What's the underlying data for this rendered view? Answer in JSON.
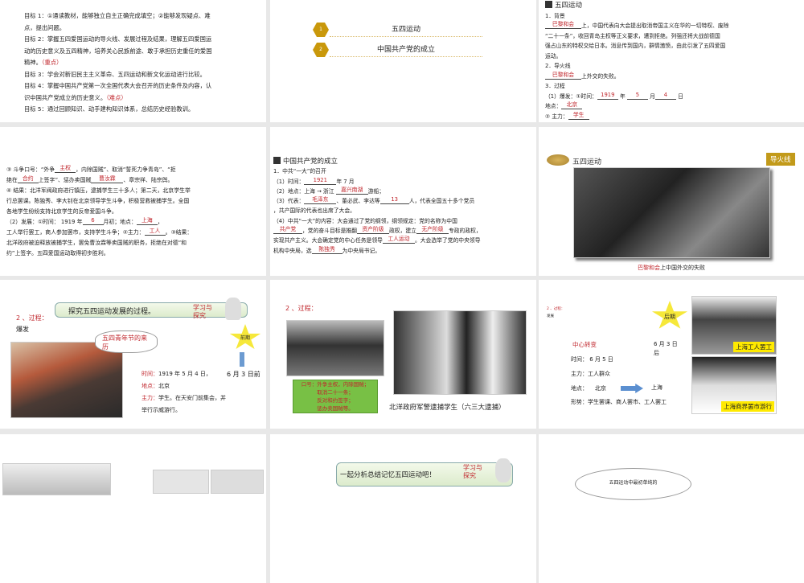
{
  "slide1": {
    "lines": [
      {
        "text": "目标 1：①通读教材，能够独立自主正确完成填空；②能够发现疑点、难"
      },
      {
        "text": "点，提出问题。"
      },
      {
        "text": "目标 2：掌握五四爱国运动的导火线、发展过程及结果，理解五四爱国运"
      },
      {
        "text": "动的历史意义及五四精神，培养关心民族前途、敢于承担历史重任的爱国"
      },
      {
        "text": "精神。",
        "mark": "（重点）"
      },
      {
        "text": "目标 3：学会对新旧民主主义革命、五四运动和新文化运动进行比较。"
      },
      {
        "text": "目标 4：掌握中国共产党第一次全国代表大会召开的历史条件及内容，认"
      },
      {
        "text": "识中国共产党成立的历史意义。",
        "mark": "（难点）"
      },
      {
        "text": "目标 5：通过回顾知识、动手建构知识体系，总结历史经验教训。"
      }
    ]
  },
  "slide2": {
    "items": [
      {
        "num": "1",
        "title": "五四运动"
      },
      {
        "num": "2",
        "title": "中国共产党的成立"
      }
    ]
  },
  "slide3": {
    "title": "五四运动",
    "bg_label": "1．背景",
    "bg_ans": "巴黎和会",
    "bg_text1": "上，中国代表向大会提出取消帝国主义在华的一切特权、废除",
    "bg_text2": "“二十一条”，收回青岛主权等正义要求，遭到拒绝。列强还将大战前德国",
    "bg_text3": "强占山东的特权交给日本。消息传到国内，群情激愤，由此引发了五四爱国",
    "bg_text4": "运动。",
    "fuse_label": "2．导火线",
    "fuse_ans": "巴黎和会",
    "fuse_text": "上外交的失败。",
    "proc_label": "3．过程",
    "outbreak": "（1）爆发：①时间：",
    "year": "1919",
    "y": "年",
    "month": "5",
    "m": "月",
    "day": "4",
    "d": "日",
    "place_label": "地点：",
    "place": "北京",
    "force_label": "② 主力：",
    "force": "学生"
  },
  "slide4": {
    "l1a": "③ 斗争口号：“外争",
    "a1": "主权",
    "l1b": "，内除国贼”、取消“誓死力争青岛”、“拒",
    "l2a": "绝在",
    "a2": "合约",
    "l2b": "上签字”、惩办卖国贼",
    "a3": "曹汝霖",
    "l2c": "、章宗祥、陆宗舆。",
    "l3": "④ 结果：北洋军阀政府进行镇压，逮捕学生三十多人；第二天，北京学生举",
    "l4": "行总罢课。陈独秀、李大钊在北京领导学生斗争，积极营救被捕学生。全国",
    "l5": "各地学生纷纷支持北京学生的反帝爱国斗争。",
    "l6a": "（2）发展：①时间： 1919 年",
    "a4": "6",
    "l6b": "月初；地点：",
    "a5": "上海",
    "l6c": "，",
    "l7a": "工人举行罢工，商人参加罢市，支持学生斗争；②主力：",
    "a6": "工人",
    "l7b": "。③结果：",
    "l8": "北洋政府被迫释放被捕学生，罢免曹汝霖等卖国贼的职务，拒绝在对德“和",
    "l9": "约”上签字。五四爱国运动取得初步胜利。"
  },
  "slide5": {
    "title": "中国共产党的成立",
    "h1": "1．中共“一大”的召开",
    "t1": "（1）时间：",
    "a1": "1921",
    "t1b": "年 7 月",
    "t2": "（2）地点：上海 → 浙江",
    "a2": "嘉兴南湖",
    "t2b": "游船；",
    "t3": "（3）代表：",
    "a3": "毛泽东",
    "t3b": "、董必武、李达等",
    "a4": "13",
    "t3c": "人，代表全国五十多个党员",
    "t4": "，共产国际的代表也出席了大会。",
    "t5": "（4）中共“一大”的内容：大会通过了党的纲领，纲领规定：党的名称为中国",
    "a5": "共产党",
    "t6": "，党的奋斗目标是推翻",
    "a6": "资产阶级",
    "t6b": "政权，建立",
    "a7": "无产阶级",
    "t6c": "专政的政权，",
    "t7": "实现共产主义。大会确定党的中心任务是领导",
    "a8": "工人运动",
    "t7b": "。大会选举了党的中央领导",
    "t8": "机构中央局，选",
    "a9": "陈独秀",
    "t8b": "为中央局书记。"
  },
  "slide6": {
    "title": "五四运动",
    "tag": "导火线",
    "caption_red": "巴黎和会",
    "caption": "上中国外交的失败"
  },
  "slide7": {
    "heading": "2 、过程：",
    "sub": "爆发",
    "banner": "探究五四运动发展的过程。",
    "badge": "学习与探究",
    "cloud": "五四青年节的来历",
    "star": "前期",
    "after": "6 月 3 日前",
    "time_label": "时间：",
    "time": "1919 年 5 月 4 日，",
    "place_label": "地点：",
    "place": "北京",
    "force_label": "主力：",
    "force": "学生。在天安门前集会，并举行示威游行。"
  },
  "slide8": {
    "heading": "2 、过程：",
    "slogan": [
      "口号：外争主权，内除国贼；",
      "取消二十一条；",
      "反对和约签字；",
      "惩办卖国贼等。"
    ],
    "caption": "北洋政府军警逮捕学生（六三大逮捕）"
  },
  "slide9": {
    "heading": "2 、过程：",
    "sub": "发展",
    "star": "后期",
    "shift": "中心转变",
    "date": "6 月 3 日后",
    "time": "时间： 6 月 5 日",
    "force": "主力：工人群众",
    "place_label": "地点：",
    "from": "北京",
    "to": "上海",
    "situation": "形势：学生罢课、商人罢市、工人罢工",
    "photo1": "上海工人罢工",
    "photo2": "上海商界罢市游行"
  },
  "slide11": {
    "banner": "一起分析总结记忆五四运动吧！",
    "badge": "学习与探究"
  },
  "slide12": {
    "cloud": "五四运动中最初单纯的"
  }
}
